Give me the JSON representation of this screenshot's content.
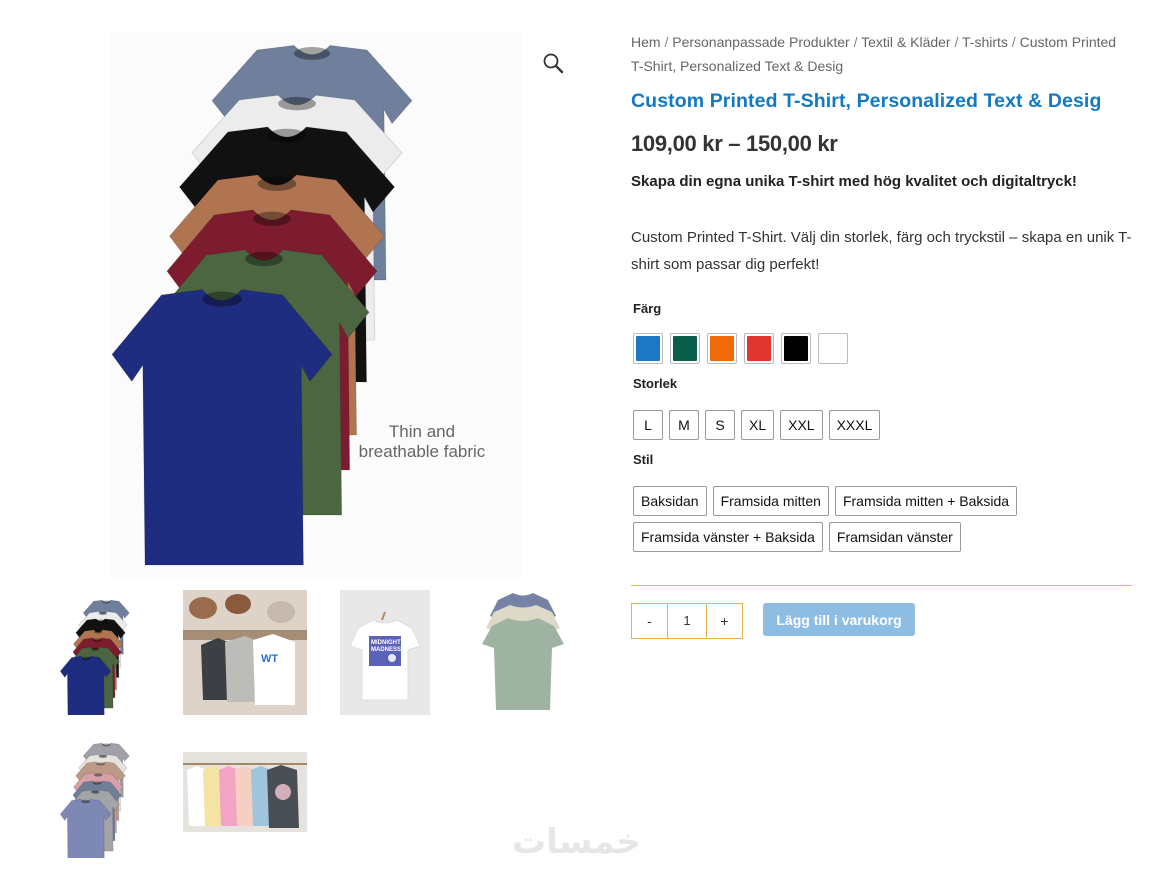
{
  "breadcrumb": {
    "items": [
      "Hem",
      "Personanpassade Produkter",
      "Textil & Kläder",
      "T-shirts"
    ],
    "current": "Custom Printed T-Shirt, Personalized Text & Desig",
    "separator": "/"
  },
  "product": {
    "title": "Custom Printed T-Shirt, Personalized Text & Desig",
    "price": "109,00 kr – 150,00 kr",
    "tagline": "Skapa din egna unika T-shirt med hög kvalitet och digitaltryck!",
    "description": "Custom Printed T-Shirt. Välj din storlek, färg och tryckstil – skapa en unik T-shirt som passar dig perfekt!"
  },
  "gallery": {
    "main_caption": [
      "Thin and",
      "breathable fabric"
    ],
    "thumb_text": [
      "MIDNIGHT",
      "MADNESS"
    ],
    "shirt_colors": [
      "#6f7f9c",
      "#ececec",
      "#111111",
      "#b07550",
      "#7d1c2f",
      "#4b6641",
      "#1f2d80"
    ]
  },
  "attributes": {
    "color": {
      "label": "Färg",
      "swatches": [
        {
          "name": "blue",
          "hex": "#1c78c4"
        },
        {
          "name": "green",
          "hex": "#0b5e4c"
        },
        {
          "name": "orange",
          "hex": "#f06a0c"
        },
        {
          "name": "red",
          "hex": "#e03530"
        },
        {
          "name": "black",
          "hex": "#000000"
        },
        {
          "name": "white",
          "hex": "#ffffff"
        }
      ]
    },
    "size": {
      "label": "Storlek",
      "options": [
        "L",
        "M",
        "S",
        "XL",
        "XXL",
        "XXXL"
      ]
    },
    "style": {
      "label": "Stil",
      "options": [
        "Baksidan",
        "Framsida mitten",
        "Framsida mitten + Baksida",
        "Framsida vänster + Baksida",
        "Framsidan vänster"
      ]
    }
  },
  "cart": {
    "minus": "-",
    "quantity": "1",
    "plus": "+",
    "add_label": "Lägg till i varukorg"
  },
  "watermark": "خمسات"
}
